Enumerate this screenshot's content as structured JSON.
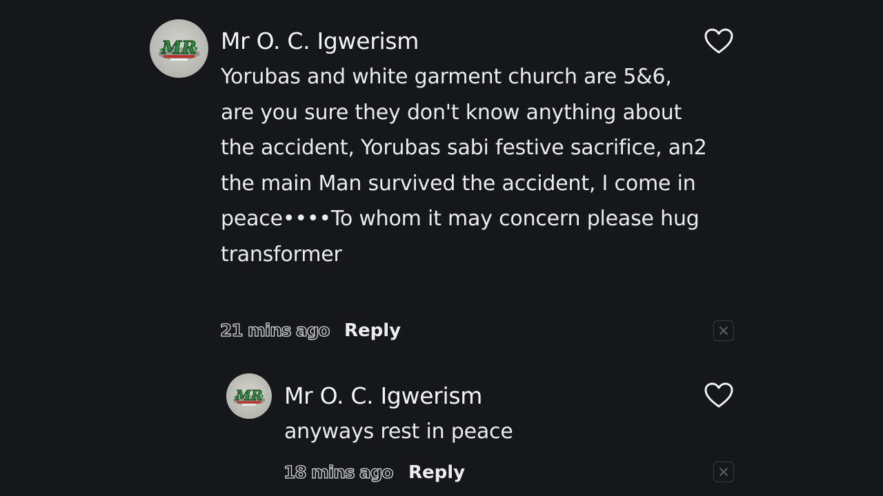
{
  "comments": [
    {
      "username": "Mr O. C. Igwerism",
      "text_lines": [
        "Yorubas and white garment church are 5&6,",
        "are you sure they don't know anything about",
        "the accident, Yorubas sabi festive sacrifice, an2",
        "the main Man survived the accident, I come in",
        "peace••••To whom it may concern please hug",
        "transformer"
      ],
      "timestamp": "21 mins ago",
      "reply_label": "Reply",
      "avatar_text": "MR",
      "avatar_icon": "mr-logo-avatar",
      "like_icon": "heart-outline-icon",
      "dismiss_icon": "close-x-icon"
    },
    {
      "username": "Mr O. C. Igwerism",
      "text": "anyways rest in peace",
      "timestamp": "18 mins ago",
      "reply_label": "Reply",
      "avatar_text": "MR",
      "avatar_icon": "mr-logo-avatar",
      "like_icon": "heart-outline-icon",
      "dismiss_icon": "close-x-icon"
    }
  ],
  "colors": {
    "background": "#16171b",
    "text": "#ececec",
    "logo_green": "#2e8b3e",
    "logo_red": "#c0302a"
  }
}
